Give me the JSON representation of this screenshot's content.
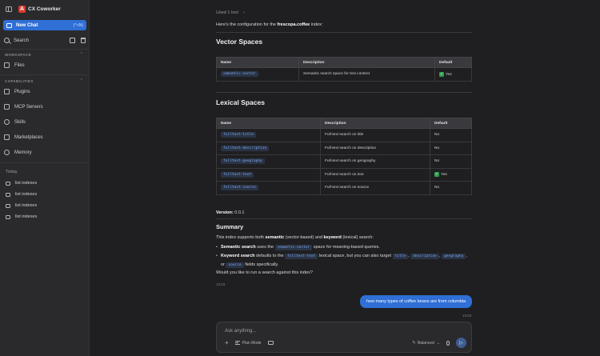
{
  "app": {
    "title": "CX Coworker",
    "logo_letter": "A",
    "accent": "#2f6fd6"
  },
  "sidebar": {
    "new_chat": {
      "label": "New Chat",
      "shortcut": "(^+N)"
    },
    "search_label": "Search",
    "workspace": {
      "label": "WORKSPACE",
      "items": [
        {
          "label": "Files"
        }
      ]
    },
    "capabilities": {
      "label": "CAPABILITIES",
      "items": [
        {
          "label": "Plugins"
        },
        {
          "label": "MCP Servers"
        },
        {
          "label": "Skills"
        },
        {
          "label": "Marketplaces"
        },
        {
          "label": "Memory"
        }
      ]
    },
    "history": {
      "label": "Today",
      "items": [
        {
          "label": "list indexes"
        },
        {
          "label": "list indexes"
        },
        {
          "label": "list indexes"
        },
        {
          "label": "list indexes"
        }
      ]
    }
  },
  "chat": {
    "used_tool": "Used 1 tool",
    "config_prefix": "Here's the configuration for the ",
    "config_index": "frescopa.coffee",
    "config_suffix": " index:",
    "vector_heading": "Vector Spaces",
    "vector_table": {
      "headers": [
        "Name",
        "Description",
        "Default"
      ],
      "rows": [
        {
          "name": "semantic-vector",
          "description": "Semantic search space for text content",
          "default": "Yes",
          "default_check": true
        }
      ]
    },
    "lexical_heading": "Lexical Spaces",
    "lexical_table": {
      "headers": [
        "Name",
        "Description",
        "Default"
      ],
      "rows": [
        {
          "name": "fulltext-title",
          "description": "Full-text search on title",
          "default": "No"
        },
        {
          "name": "fulltext-description",
          "description": "Full-text search on description",
          "default": "No"
        },
        {
          "name": "fulltext-geography",
          "description": "Full-text search on geography",
          "default": "No"
        },
        {
          "name": "fulltext-text",
          "description": "Full-text search on text",
          "default": "Yes",
          "default_check": true
        },
        {
          "name": "fulltext-source",
          "description": "Full-text search on source",
          "default": "No"
        }
      ]
    },
    "version_label": "Version:",
    "version_value": "0.0.1",
    "summary_heading": "Summary",
    "summary_intro": {
      "p1": "This index supports both ",
      "b1": "semantic",
      "p2": " (vector-based) and ",
      "b2": "keyword",
      "p3": " (lexical) search:"
    },
    "bullet1": {
      "b": "Semantic search",
      "pre": " uses the ",
      "code": "semantic-vector",
      "post": " space for meaning-based queries."
    },
    "bullet2": {
      "b": "Keyword search",
      "pre": " defaults to the ",
      "code1": "fulltext-text",
      "mid": " lexical space, but you can also target ",
      "code2": "title",
      "sep1": ", ",
      "code3": "description",
      "sep2": ",",
      "code4": "geography",
      "sep3": ", or ",
      "code5": "source",
      "post": " fields specifically."
    },
    "question": "Would you like to run a search against this index?",
    "assistant_time": "13:03",
    "user_message": "how many types of coffee beans are from columbia",
    "user_time": "13:04"
  },
  "composer": {
    "placeholder": "Ask anything...",
    "plan_mode": "Plan Mode",
    "model_mode": "Balanced"
  }
}
